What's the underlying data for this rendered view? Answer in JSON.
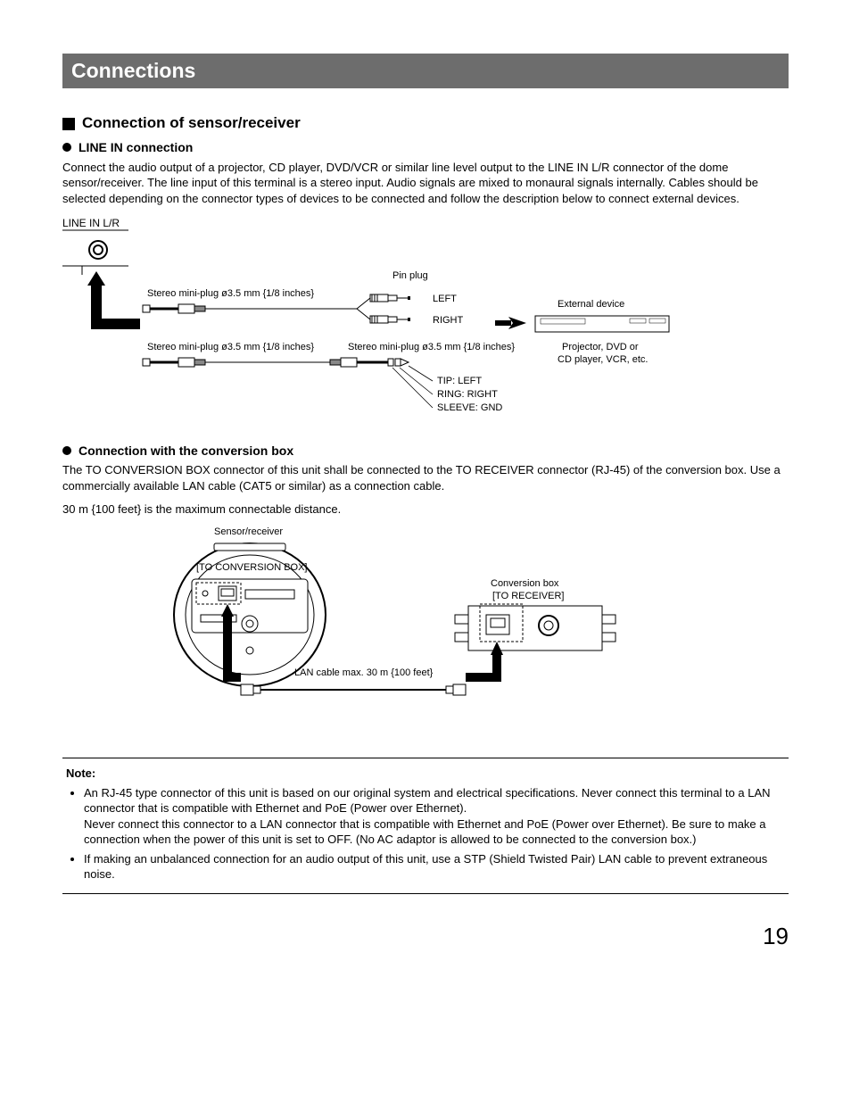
{
  "header": {
    "title": "Connections"
  },
  "section1": {
    "heading": "Connection of sensor/receiver",
    "sub_a": {
      "heading": "LINE IN connection",
      "body": "Connect the audio output of a projector, CD player, DVD/VCR or similar line level output to the LINE IN L/R connector of the dome sensor/receiver. The line input of this terminal is a stereo input. Audio signals are mixed to monaural signals internally. Cables should be selected depending on the connector types of devices to be connected and follow the description below to connect external devices.",
      "labels": {
        "linein": "LINE IN L/R",
        "mini1": "Stereo mini-plug ø3.5 mm {1/8 inches}",
        "mini2": "Stereo mini-plug ø3.5 mm {1/8 inches}",
        "mini3": "Stereo mini-plug ø3.5 mm {1/8 inches}",
        "pin": "Pin plug",
        "left": "LEFT",
        "right": "RIGHT",
        "ext": "External device",
        "proj": "Projector, DVD or",
        "proj2": "CD player, VCR, etc.",
        "tip": "TIP: LEFT",
        "ring": "RING: RIGHT",
        "sleeve": "SLEEVE: GND"
      }
    },
    "sub_b": {
      "heading": "Connection with the conversion box",
      "body1": "The TO CONVERSION BOX connector of this unit shall be connected to the TO RECEIVER connector (RJ-45) of the conversion box. Use a commercially available LAN cable (CAT5 or similar) as a connection cable.",
      "body2": "30 m {100 feet} is the maximum connectable distance.",
      "labels": {
        "sensor": "Sensor/receiver",
        "toconv": "[TO CONVERSION BOX]",
        "convbox": "Conversion box",
        "torecv": "[TO RECEIVER]",
        "lan": "LAN cable max. 30 m {100 feet}"
      }
    }
  },
  "note": {
    "title": "Note:",
    "items": [
      "An RJ-45 type connector of this unit is based on our original system and electrical specifications. Never connect this terminal to a LAN connector that is compatible with Ethernet and PoE (Power over Ethernet).\nNever connect this connector to a LAN connector that is compatible with Ethernet and PoE (Power over Ethernet). Be sure to make a connection when the power of this unit is set to OFF. (No AC adaptor is allowed to be connected to the conversion box.)",
      "If making an unbalanced connection for an audio output of this unit, use a STP (Shield Twisted Pair) LAN cable to prevent extraneous noise."
    ]
  },
  "page": "19"
}
